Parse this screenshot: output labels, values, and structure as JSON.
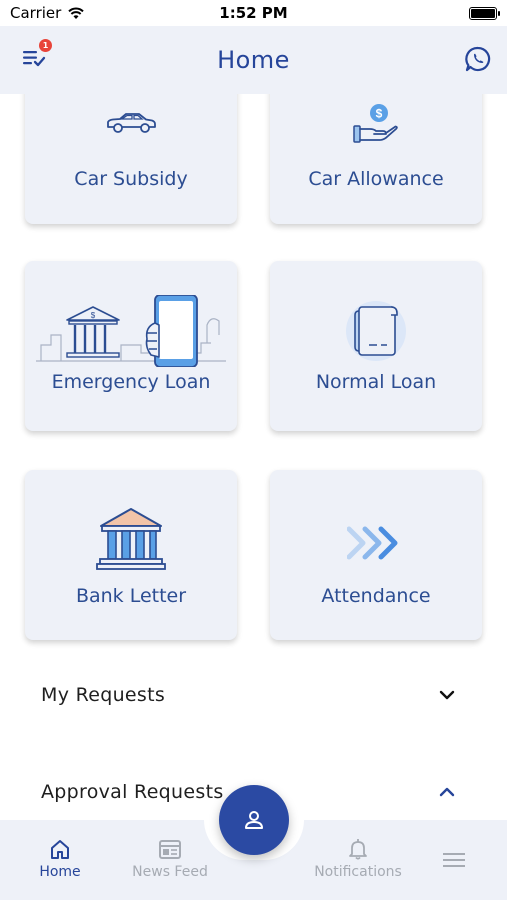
{
  "status_bar": {
    "carrier": "Carrier",
    "time": "1:52 PM"
  },
  "header": {
    "title": "Home",
    "menu_badge": "1"
  },
  "cards": [
    {
      "label": "Car Subsidy",
      "icon": "car-icon"
    },
    {
      "label": "Car Allowance",
      "icon": "hand-coin-icon"
    },
    {
      "label": "Emergency Loan",
      "icon": "bank-phone-icon"
    },
    {
      "label": "Normal Loan",
      "icon": "scroll-icon"
    },
    {
      "label": "Bank Letter",
      "icon": "bank-building-icon"
    },
    {
      "label": "Attendance",
      "icon": "chevrons-right-icon"
    }
  ],
  "sections": {
    "my_requests": "My Requests",
    "approval_requests": "Approval Requests"
  },
  "bottom_nav": {
    "home": "Home",
    "news_feed": "News Feed",
    "notifications": "Notifications"
  },
  "colors": {
    "primary": "#26459a",
    "card_bg": "#eef1f8",
    "badge": "#e8443a",
    "inactive": "#a6abb3"
  }
}
